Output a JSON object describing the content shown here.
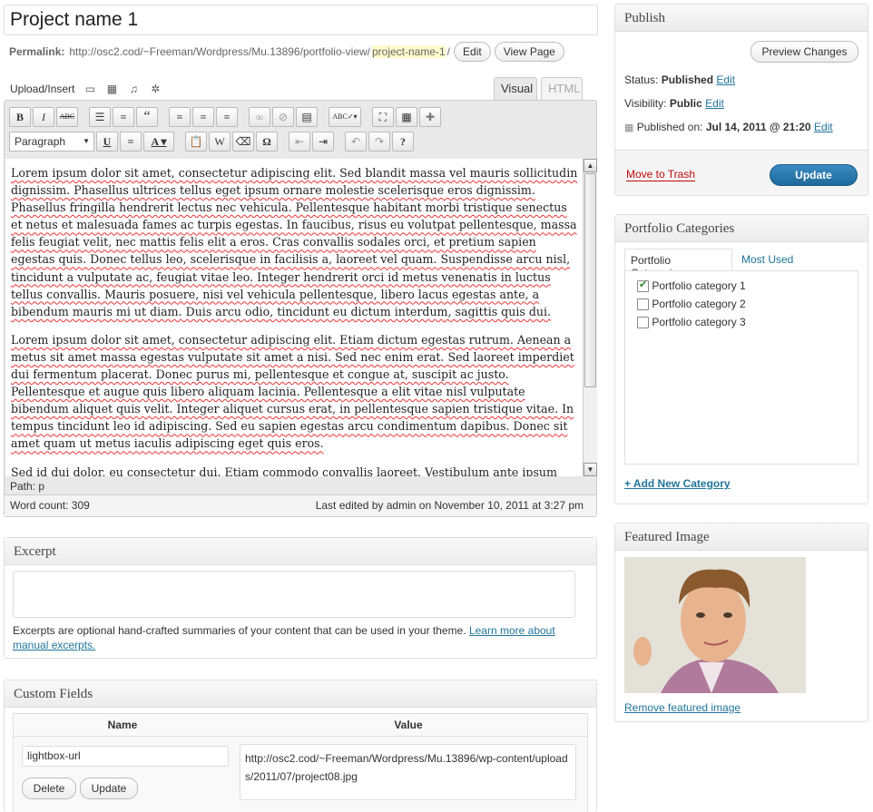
{
  "post": {
    "title": "Project name 1"
  },
  "permalink": {
    "label": "Permalink:",
    "url_base": "http://osc2.cod/~Freeman/Wordpress/Mu.13896/portfolio-view/",
    "slug": "project-name-1",
    "trail": "/",
    "edit_label": "Edit",
    "view_label": "View Page"
  },
  "media": {
    "label": "Upload/Insert",
    "icons": [
      "image-icon",
      "video-icon",
      "audio-icon",
      "media-icon"
    ]
  },
  "tabs": {
    "visual": "Visual",
    "html": "HTML"
  },
  "toolbar": {
    "row1": [
      "B",
      "I",
      "ABC",
      "ul",
      "ol",
      "“",
      "left",
      "center",
      "right",
      "link",
      "unlink",
      "more",
      "spell",
      "full",
      "kitchen",
      "plugin"
    ],
    "format": "Paragraph",
    "row2": [
      "U",
      "justify",
      "A",
      "paste-text",
      "paste-word",
      "clear",
      "Ω",
      "outdent",
      "indent",
      "undo",
      "redo",
      "help"
    ]
  },
  "content": {
    "paragraphs": [
      "Lorem ipsum dolor sit amet, consectetur adipiscing elit. Sed blandit massa vel mauris sollicitudin dignissim. Phasellus ultrices tellus eget ipsum ornare molestie scelerisque eros dignissim. Phasellus fringilla hendrerit lectus nec vehicula. Pellentesque habitant morbi tristique senectus et netus et malesuada fames ac turpis egestas. In faucibus, risus eu volutpat pellentesque, massa felis feugiat velit, nec mattis felis elit a eros. Cras convallis sodales orci, et pretium sapien egestas quis. Donec tellus leo, scelerisque in facilisis a, laoreet vel quam. Suspendisse arcu nisl, tincidunt a vulputate ac, feugiat vitae leo. Integer hendrerit orci id metus venenatis in luctus tellus convallis. Mauris posuere, nisi vel vehicula pellentesque, libero lacus egestas ante, a bibendum mauris mi ut diam. Duis arcu odio, tincidunt eu dictum interdum, sagittis quis dui.",
      "Lorem ipsum dolor sit amet, consectetur adipiscing elit. Etiam dictum egestas rutrum. Aenean a metus sit amet massa egestas vulputate sit amet a nisi. Sed nec enim erat. Sed laoreet imperdiet dui fermentum placerat. Donec purus mi, pellentesque et congue at, suscipit ac justo. Pellentesque et augue quis libero aliquam lacinia. Pellentesque a elit vitae nisl vulputate bibendum aliquet quis velit. Integer aliquet cursus erat, in pellentesque sapien tristique vitae. In tempus tincidunt leo id adipiscing. Sed eu sapien egestas arcu condimentum dapibus. Donec sit amet quam ut metus iaculis adipiscing eget quis eros.",
      "Sed id dui dolor, eu consectetur dui. Etiam commodo convallis laoreet. Vestibulum ante ipsum"
    ],
    "path": "Path: p",
    "word_count": "Word count: 309",
    "last_edited": "Last edited by admin on November 10, 2011 at 3:27 pm"
  },
  "excerpt": {
    "title": "Excerpt",
    "help": "Excerpts are optional hand-crafted summaries of your content that can be used in your theme.",
    "link": "Learn more about manual excerpts."
  },
  "custom_fields": {
    "title": "Custom Fields",
    "col_name": "Name",
    "col_value": "Value",
    "name_value": "lightbox-url",
    "value_text": "http://osc2.cod/~Freeman/Wordpress/Mu.13896/wp-content/uploads/2011/07/project08.jpg",
    "delete_label": "Delete",
    "update_label": "Update"
  },
  "publish": {
    "title": "Publish",
    "preview_label": "Preview Changes",
    "status_label": "Status:",
    "status_value": "Published",
    "visibility_label": "Visibility:",
    "visibility_value": "Public",
    "published_label": "Published on:",
    "published_value": "Jul 14, 2011 @ 21:20",
    "edit_label": "Edit",
    "trash_label": "Move to Trash",
    "update_label": "Update"
  },
  "categories": {
    "title": "Portfolio Categories",
    "tab_all": "Portfolio Categories",
    "tab_used": "Most Used",
    "items": [
      {
        "label": "Portfolio category 1",
        "checked": true
      },
      {
        "label": "Portfolio category 2",
        "checked": false
      },
      {
        "label": "Portfolio category 3",
        "checked": false
      }
    ],
    "add_label": "+ Add New Category"
  },
  "featured": {
    "title": "Featured Image",
    "remove_label": "Remove featured image"
  },
  "colors": {
    "link": "#21759b",
    "update_button": "#2a78ab",
    "trash": "#bc0b0b"
  }
}
